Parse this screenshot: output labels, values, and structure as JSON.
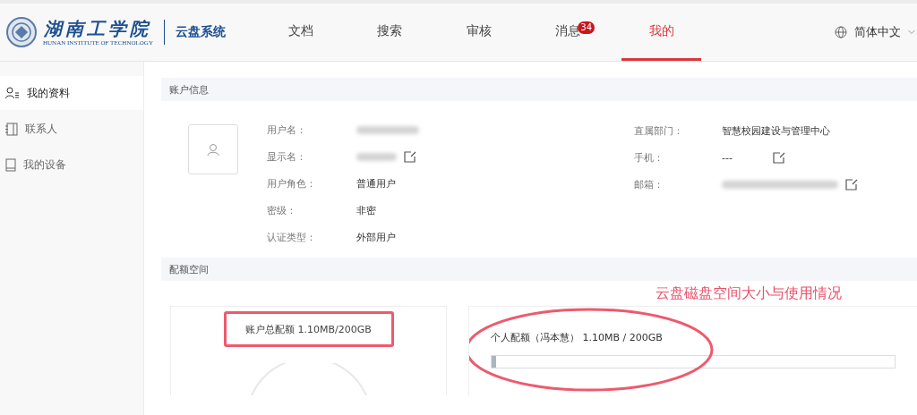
{
  "header": {
    "logo": {
      "name": "湖南工学院",
      "subtitle": "HUNAN INSTITUTE OF TECHNOLOGY",
      "product": "云盘系统"
    },
    "nav": [
      {
        "label": "文档",
        "selected": false
      },
      {
        "label": "搜索",
        "selected": false
      },
      {
        "label": "审核",
        "selected": false
      },
      {
        "label": "消息",
        "selected": false,
        "badge": "34"
      },
      {
        "label": "我的",
        "selected": true
      }
    ],
    "language": "简体中文"
  },
  "sidebar": {
    "items": [
      {
        "label": "我的资料",
        "kind": "profile",
        "selected": true
      },
      {
        "label": "联系人",
        "kind": "contacts",
        "selected": false
      },
      {
        "label": "我的设备",
        "kind": "device",
        "selected": false
      }
    ]
  },
  "account_info": {
    "title": "账户信息",
    "left_fields": [
      {
        "label": "用户名：",
        "redacted": true,
        "editable": false
      },
      {
        "label": "显示名：",
        "redacted": true,
        "editable": true
      },
      {
        "label": "用户角色：",
        "value": "普通用户",
        "redacted": false,
        "editable": false
      },
      {
        "label": "密级：",
        "value": "非密",
        "redacted": false,
        "editable": false
      },
      {
        "label": "认证类型：",
        "value": "外部用户",
        "redacted": false,
        "editable": false
      }
    ],
    "right_fields": [
      {
        "label": "直属部门：",
        "value": "智慧校园建设与管理中心",
        "redacted": false,
        "editable": false
      },
      {
        "label": "手机：",
        "value": "---",
        "redacted": false,
        "editable": true
      },
      {
        "label": "邮箱：",
        "redacted": true,
        "editable": true
      }
    ]
  },
  "quota": {
    "title": "配额空间",
    "annotation": "云盘磁盘空间大小与使用情况",
    "total": {
      "text": "账户总配额 1.10MB/200GB",
      "highlighted": true
    },
    "personal": {
      "text": "个人配额（冯本慧） 1.10MB / 200GB",
      "level": 0.01,
      "highlighted": true
    }
  }
}
